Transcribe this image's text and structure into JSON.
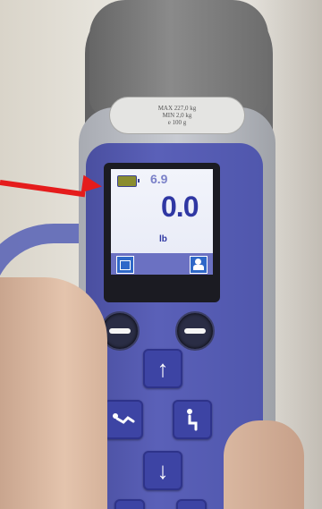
{
  "label_plate": {
    "max_line": "MAX   227,0 kg",
    "min_line": "MIN    2,0 kg",
    "step_line": "e     100 g"
  },
  "display": {
    "small_reading": "6.9",
    "main_reading": "0.0",
    "unit": "lb"
  },
  "icons": {
    "battery": "battery-icon",
    "left_tile": "memory-icon",
    "right_tile": "weigh-person-icon",
    "up": "arrow-up-icon",
    "down": "arrow-down-icon",
    "recline": "recline-icon",
    "sit": "sit-icon"
  },
  "glyphs": {
    "up": "↑",
    "down": "↓"
  },
  "colors": {
    "panel": "#5057ad",
    "screen_text": "#2f37a3",
    "annotation_arrow": "#e51c1c"
  }
}
